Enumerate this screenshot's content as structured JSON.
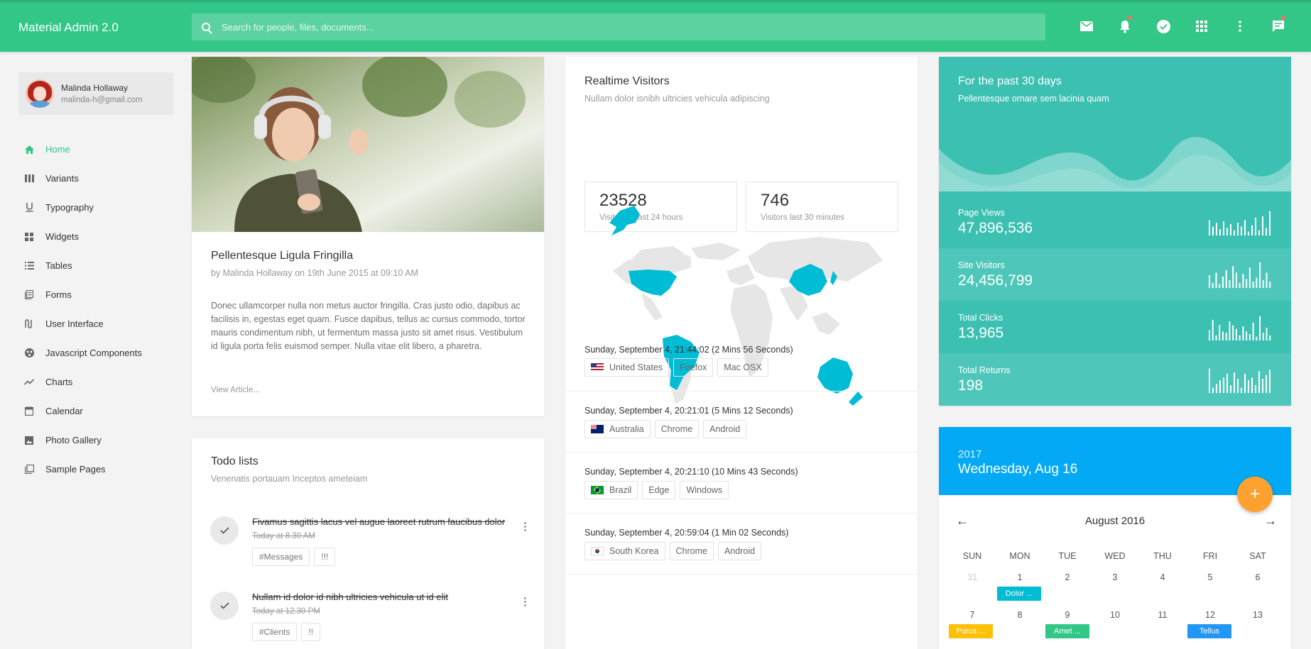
{
  "header": {
    "brand": "Material Admin 2.0",
    "search_placeholder": "Search for people, files, documents...",
    "icons": [
      "mail-icon",
      "notifications-icon",
      "check-circle-icon",
      "apps-grid-icon",
      "more-vert-icon",
      "chat-icon"
    ],
    "accent": "#32c787"
  },
  "profile": {
    "name": "Malinda Hollaway",
    "email": "malinda-h@gmail.com"
  },
  "nav": [
    {
      "label": "Home",
      "icon": "home-icon",
      "active": true
    },
    {
      "label": "Variants",
      "icon": "columns-icon"
    },
    {
      "label": "Typography",
      "icon": "underline-icon"
    },
    {
      "label": "Widgets",
      "icon": "widgets-icon"
    },
    {
      "label": "Tables",
      "icon": "list-icon"
    },
    {
      "label": "Forms",
      "icon": "forms-icon"
    },
    {
      "label": "User Interface",
      "icon": "ui-icon"
    },
    {
      "label": "Javascript Components",
      "icon": "js-components-icon"
    },
    {
      "label": "Charts",
      "icon": "trending-icon"
    },
    {
      "label": "Calendar",
      "icon": "calendar-icon"
    },
    {
      "label": "Photo Gallery",
      "icon": "image-icon"
    },
    {
      "label": "Sample Pages",
      "icon": "pages-icon"
    }
  ],
  "article": {
    "title": "Pellentesque Ligula Fringilla",
    "meta": "by Malinda Hollaway on 19th June 2015 at 09:10 AM",
    "body": "Donec ullamcorper nulla non metus auctor fringilla. Cras justo odio, dapibus ac facilisis in, egestas eget quam. Fusce dapibus, tellus ac cursus commodo, tortor mauris condimentum nibh, ut fermentum massa justo sit amet risus. Vestibulum id ligula porta felis euismod semper. Nulla vitae elit libero, a pharetra.",
    "link": "View Article..."
  },
  "todo": {
    "title": "Todo lists",
    "subtitle": "Venenatis portauam Inceptos ameteiam",
    "items": [
      {
        "text": "Fivamus sagittis lacus vel augue laoreet rutrum faucibus dolor",
        "time": "Today at 8.30 AM",
        "tags": [
          "#Messages",
          "!!!"
        ]
      },
      {
        "text": "Nullam id dolor id nibh ultricies vehicula ut id elit",
        "time": "Today at 12.30 PM",
        "tags": [
          "#Clients",
          "!!"
        ]
      }
    ]
  },
  "realtime": {
    "title": "Realtime Visitors",
    "subtitle": "Nullam dolor isnibh ultricies vehicula adipiscing",
    "stats": [
      {
        "value": "23528",
        "label": "Visitor for last 24 hours"
      },
      {
        "value": "746",
        "label": "Visitors last 30 minutes"
      }
    ],
    "highlighted_countries": [
      "United States",
      "Brazil",
      "China",
      "Australia",
      "Japan",
      "New Zealand"
    ],
    "visits": [
      {
        "time": "Sunday, September 4, 21:44:02 (2 Mins 56 Seconds)",
        "country": "United States",
        "browser": "Firefox",
        "os": "Mac OSX",
        "flag": "us-flag-icon"
      },
      {
        "time": "Sunday, September 4, 20:21:01 (5 Mins 12 Seconds)",
        "country": "Australia",
        "browser": "Chrome",
        "os": "Android",
        "flag": "au-flag-icon"
      },
      {
        "time": "Sunday, September 4, 20:21:10 (10 Mins 43 Seconds)",
        "country": "Brazil",
        "browser": "Edge",
        "os": "Windows",
        "flag": "br-flag-icon"
      },
      {
        "time": "Sunday, September 4, 20:59:04 (1 Min 02 Seconds)",
        "country": "South Korea",
        "browser": "Chrome",
        "os": "Android",
        "flag": "kr-flag-icon"
      }
    ]
  },
  "stats_card": {
    "title": "For the past 30 days",
    "subtitle": "Pellentesque ornare sem lacinia quam",
    "color": "#3bc0b2",
    "rows": [
      {
        "label": "Page Views",
        "value": "47,896,536",
        "bars": [
          0.6,
          0.35,
          0.5,
          0.25,
          0.55,
          0.3,
          0.45,
          0.2,
          0.5,
          0.35,
          0.6,
          0.15,
          0.4,
          0.7,
          0.2,
          0.75,
          0.3,
          0.95
        ]
      },
      {
        "label": "Site Visitors",
        "value": "24,456,799",
        "bars": [
          0.5,
          0.2,
          0.6,
          0.15,
          0.45,
          0.7,
          0.3,
          0.85,
          0.6,
          0.2,
          0.55,
          0.35,
          0.8,
          0.25,
          0.4,
          1.0,
          0.3,
          0.6,
          0.25
        ]
      },
      {
        "label": "Total Clicks",
        "value": "13,965",
        "bars": [
          0.4,
          0.8,
          0.2,
          0.6,
          0.35,
          0.3,
          0.75,
          0.6,
          0.45,
          0.2,
          0.55,
          0.35,
          0.25,
          0.7,
          0.15,
          0.95,
          0.3,
          0.5,
          0.2
        ]
      },
      {
        "label": "Total Returns",
        "value": "198",
        "bars": [
          0.95,
          0.2,
          0.35,
          0.5,
          0.6,
          0.75,
          0.3,
          0.8,
          0.55,
          0.2,
          0.75,
          0.5,
          0.6,
          0.3,
          0.85,
          0.55,
          0.7,
          0.9
        ]
      }
    ]
  },
  "calendar": {
    "year": "2017",
    "date": "Wednesday, Aug 16",
    "month": "August 2016",
    "weekdays": [
      "SUN",
      "MON",
      "TUE",
      "WED",
      "THU",
      "FRI",
      "SAT"
    ],
    "week1": [
      "31",
      "1",
      "2",
      "3",
      "4",
      "5",
      "6"
    ],
    "week2": [
      "7",
      "8",
      "9",
      "10",
      "11",
      "12",
      "13"
    ],
    "events": [
      {
        "label": "Dolor ...",
        "color": "#00bcd4"
      },
      {
        "label": "Purus ...",
        "color": "#ffc107"
      },
      {
        "label": "Amet ...",
        "color": "#32c787"
      },
      {
        "label": "Tellus",
        "color": "#2196f3"
      }
    ],
    "header_color": "#03a9f4",
    "fab_color": "#ffa12f"
  }
}
